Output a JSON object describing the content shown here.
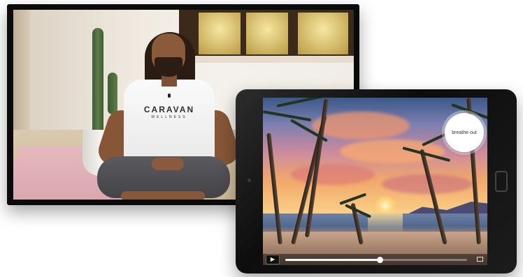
{
  "meditation_video": {
    "brand": "CARAVAN",
    "brand_sub": "WELLNESS"
  },
  "tablet_player": {
    "breathe_prompt": "breathe out",
    "playback_progress": 0.52,
    "icons": {
      "play": "play-icon",
      "fullscreen": "fullscreen-icon"
    }
  },
  "colors": {
    "shirt": "#fafafa",
    "sky_top": "#3a5887",
    "sunset": "#f2a86a",
    "device_frame": "#0b0b0b"
  }
}
